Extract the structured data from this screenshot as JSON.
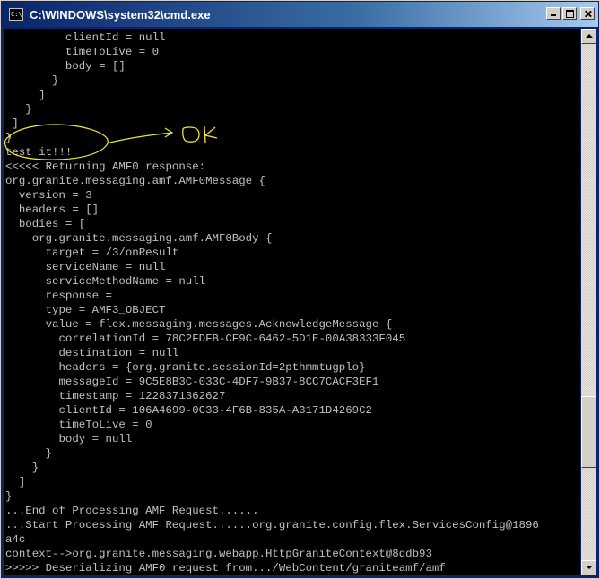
{
  "window": {
    "title": "C:\\WINDOWS\\system32\\cmd.exe",
    "icon": "cmd-app-icon",
    "icon_text": "C:\\"
  },
  "console": {
    "lines": [
      "         clientId = null",
      "         timeToLive = 0",
      "         body = []",
      "       }",
      "     ]",
      "   }",
      " ]",
      "}",
      "test it!!!",
      "<<<<< Returning AMF0 response:",
      "org.granite.messaging.amf.AMF0Message {",
      "  version = 3",
      "  headers = []",
      "  bodies = [",
      "    org.granite.messaging.amf.AMF0Body {",
      "      target = /3/onResult",
      "      serviceName = null",
      "      serviceMethodName = null",
      "      response =",
      "      type = AMF3_OBJECT",
      "      value = flex.messaging.messages.AcknowledgeMessage {",
      "        correlationId = 78C2FDFB-CF9C-6462-5D1E-00A38333F045",
      "        destination = null",
      "        headers = {org.granite.sessionId=2pthmmtugplo}",
      "        messageId = 9C5E8B3C-033C-4DF7-9B37-8CC7CACF3EF1",
      "        timestamp = 1228371362627",
      "        clientId = 106A4699-0C33-4F6B-835A-A3171D4269C2",
      "        timeToLive = 0",
      "        body = null",
      "      }",
      "    }",
      "  ]",
      "}",
      "...End of Processing AMF Request......",
      "...Start Processing AMF Request......org.granite.config.flex.ServicesConfig@1896",
      "a4c",
      "context-->org.granite.messaging.webapp.HttpGraniteContext@8ddb93",
      ">>>>> Deserializing AMF0 request from.../WebContent/graniteamf/amf"
    ]
  },
  "annotation": {
    "handwritten_text": "OK",
    "color": "#f0e830"
  },
  "colors": {
    "console_bg": "#000000",
    "console_fg": "#c0c0c0",
    "titlebar_start": "#0a246a",
    "titlebar_end": "#a6caf0"
  }
}
